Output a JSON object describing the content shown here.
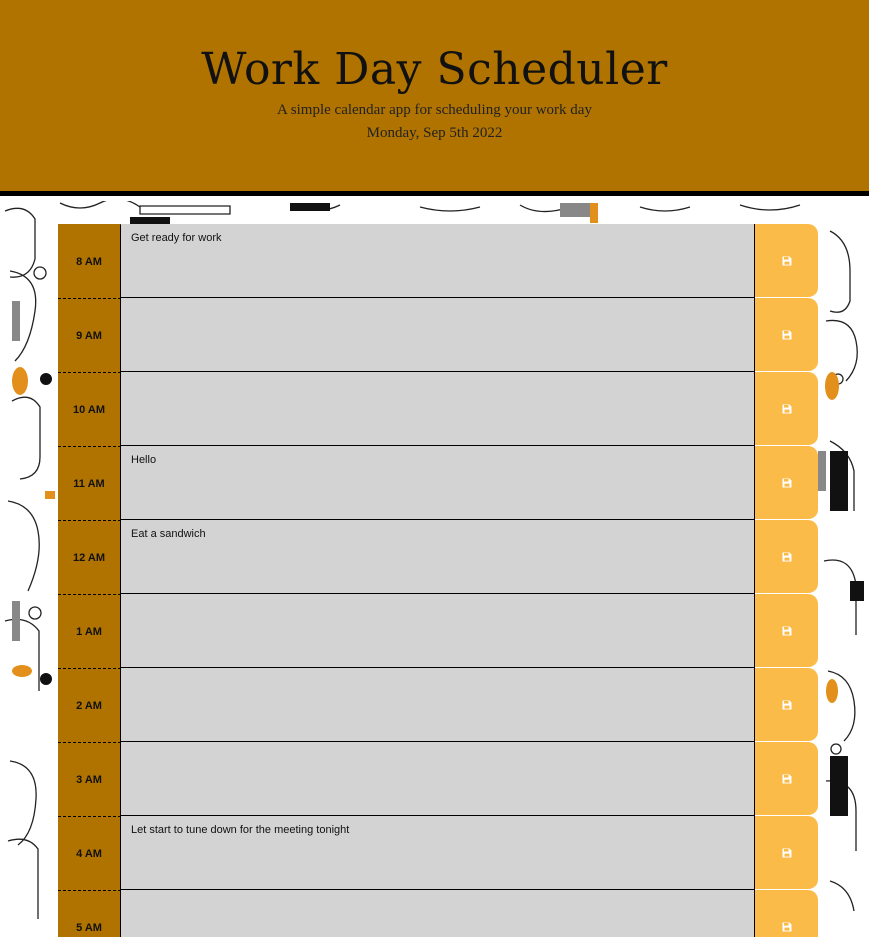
{
  "header": {
    "title": "Work Day Scheduler",
    "subtitle": "A simple calendar app for scheduling your work day",
    "current_date": "Monday, Sep 5th 2022"
  },
  "colors": {
    "header_bg": "#b07300",
    "hour_bg": "#b07300",
    "description_bg": "#d3d3d3",
    "save_bg": "#fbbb48"
  },
  "save_icon": "floppy-disk-icon",
  "time_blocks": [
    {
      "hour": "8 AM",
      "text": "Get ready for work"
    },
    {
      "hour": "9 AM",
      "text": ""
    },
    {
      "hour": "10 AM",
      "text": ""
    },
    {
      "hour": "11 AM",
      "text": "Hello"
    },
    {
      "hour": "12 AM",
      "text": "Eat a sandwich"
    },
    {
      "hour": "1 AM",
      "text": ""
    },
    {
      "hour": "2 AM",
      "text": ""
    },
    {
      "hour": "3 AM",
      "text": ""
    },
    {
      "hour": "4 AM",
      "text": "Let start to tune down for the meeting tonight"
    },
    {
      "hour": "5 AM",
      "text": ""
    }
  ]
}
